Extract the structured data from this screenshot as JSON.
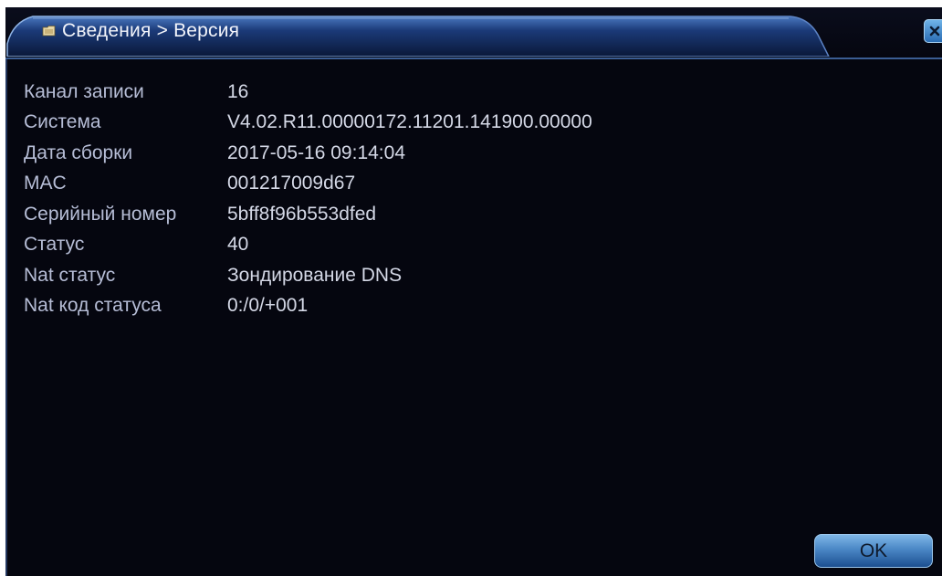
{
  "window": {
    "title": "Сведения > Версия",
    "title_icon": "folder-icon",
    "close_icon": "close-icon"
  },
  "info": {
    "rows": [
      {
        "label": "Канал записи",
        "value": "16"
      },
      {
        "label": "Система",
        "value": "V4.02.R11.00000172.11201.141900.00000"
      },
      {
        "label": "Дата сборки",
        "value": "2017-05-16 09:14:04"
      },
      {
        "label": "MAC",
        "value": "001217009d67"
      },
      {
        "label": "Серийный номер",
        "value": "5bff8f96b553dfed"
      },
      {
        "label": "Статус",
        "value": "40"
      },
      {
        "label": "Nat статус",
        "value": "Зондирование DNS"
      },
      {
        "label": "Nat код статуса",
        "value": "0:/0/+001"
      }
    ]
  },
  "footer": {
    "ok_label": "OK"
  },
  "colors": {
    "background": "#05060f",
    "label": "#b6bdd6",
    "value": "#d4d8e6",
    "accent": "#3b5d93",
    "button": "#4a87c6"
  }
}
